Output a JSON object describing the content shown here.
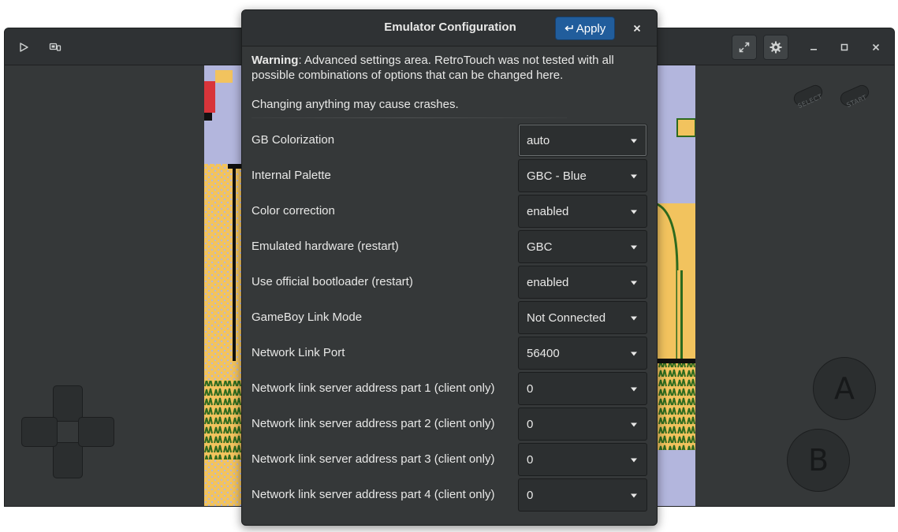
{
  "main_window": {
    "game_controls": {
      "select_label": "SELECT",
      "start_label": "START",
      "a_label": "A",
      "b_label": "B"
    }
  },
  "dialog": {
    "title": "Emulator Configuration",
    "apply_label": "Apply",
    "warning_bold": "Warning",
    "warning_text": ": Advanced settings area. RetroTouch was not tested with all possible combinations of options that can be changed here.",
    "changing_text": "Changing anything may cause crashes.",
    "options": [
      {
        "label": "GB Colorization",
        "value": "auto"
      },
      {
        "label": "Internal Palette",
        "value": "GBC - Blue"
      },
      {
        "label": "Color correction",
        "value": "enabled"
      },
      {
        "label": "Emulated hardware (restart)",
        "value": "GBC"
      },
      {
        "label": "Use official bootloader (restart)",
        "value": "enabled"
      },
      {
        "label": "GameBoy Link Mode",
        "value": "Not Connected"
      },
      {
        "label": "Network Link Port",
        "value": "56400"
      },
      {
        "label": "Network link server address part 1 (client only)",
        "value": "0"
      },
      {
        "label": "Network link server address part 2 (client only)",
        "value": "0"
      },
      {
        "label": "Network link server address part 3 (client only)",
        "value": "0"
      },
      {
        "label": "Network link server address part 4 (client only)",
        "value": "0"
      }
    ]
  },
  "colors": {
    "accent": "#215d9c",
    "window_bg": "#353839",
    "header_bg": "#2f3234",
    "game_screen_bg": "#b3b6dd"
  }
}
